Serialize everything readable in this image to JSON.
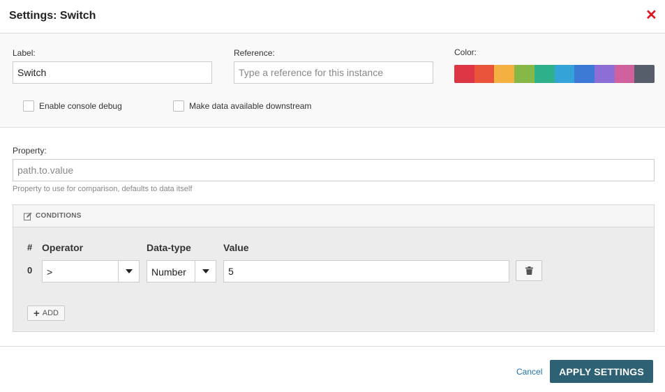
{
  "dialog": {
    "title": "Settings: Switch",
    "close_icon": "close-icon"
  },
  "general": {
    "label_caption": "Label:",
    "label_value": "Switch",
    "reference_caption": "Reference:",
    "reference_placeholder": "Type a reference for this instance",
    "color_caption": "Color:",
    "colors": [
      "#dc3545",
      "#e8533a",
      "#f4b040",
      "#86b848",
      "#2eb08a",
      "#34a3d8",
      "#3d7ad6",
      "#8c6ed6",
      "#d0609e",
      "#565d6b"
    ],
    "checkboxes": [
      {
        "label": "Enable console debug",
        "checked": false
      },
      {
        "label": "Make data available downstream",
        "checked": false
      }
    ]
  },
  "property": {
    "caption": "Property:",
    "placeholder": "path.to.value",
    "help": "Property to use for comparison, defaults to data itself"
  },
  "conditions": {
    "title": "CONDITIONS",
    "columns": {
      "index": "#",
      "operator": "Operator",
      "datatype": "Data-type",
      "value": "Value"
    },
    "rows": [
      {
        "index": "0",
        "operator": ">",
        "datatype": "Number",
        "value": "5"
      }
    ],
    "add_label": "ADD"
  },
  "footer": {
    "cancel_label": "Cancel",
    "apply_label": "APPLY SETTINGS"
  }
}
